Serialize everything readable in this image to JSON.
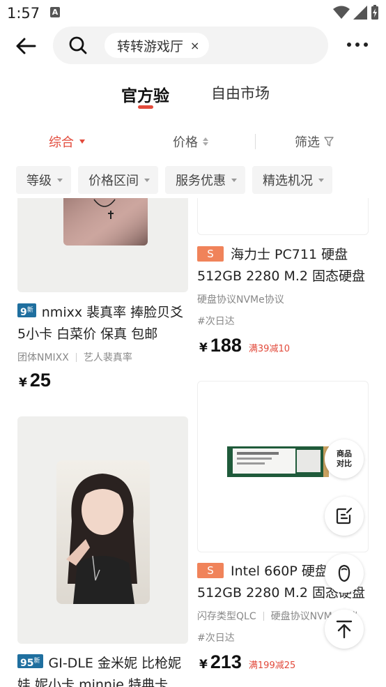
{
  "status": {
    "time": "1:57",
    "notif_icon": "A"
  },
  "header": {
    "search_chip": "转转游戏厅",
    "chip_close": "×"
  },
  "tabs": [
    {
      "label": "官方验"
    },
    {
      "label": "自由市场"
    }
  ],
  "sort": {
    "comprehensive": "综合",
    "price": "价格",
    "filter": "筛选"
  },
  "filters": [
    "等级",
    "价格区间",
    "服务优惠",
    "精选机况"
  ],
  "products": [
    {
      "grade": "9",
      "grade_suffix": "新",
      "title": "nmixx 裴真率 捧脸贝爻5小卡 白菜价 保真 包邮",
      "tags": [
        "团体NMIXX",
        "艺人裴真率"
      ],
      "price_symbol": "¥",
      "price": "25"
    },
    {
      "badge": "S",
      "title": "海力士 PC711 硬盘 512GB 2280 M.2 固态硬盘",
      "tags": [
        "硬盘协议NVMe协议"
      ],
      "hash_tag": "#次日达",
      "price_symbol": "¥",
      "price": "188",
      "promo": "满39减10"
    },
    {
      "grade": "95",
      "grade_suffix": "新",
      "title": "GI-DLE 金米妮 比枪妮娃 妮小卡 minnie 特典卡 保",
      "price_symbol": "¥"
    },
    {
      "badge": "S",
      "title": "Intel 660P 硬盘 512GB 2280 M.2 固态硬盘",
      "tags": [
        "闪存类型QLC",
        "硬盘协议NVMe协议"
      ],
      "hash_tag": "#次日达",
      "price_symbol": "¥",
      "price": "213",
      "promo": "满199减25"
    }
  ],
  "float": {
    "compare": "商品对比"
  },
  "colors": {
    "accent": "#e24a3b",
    "grade_badge": "#1f6f9f",
    "s_badge": "#f0835a"
  }
}
